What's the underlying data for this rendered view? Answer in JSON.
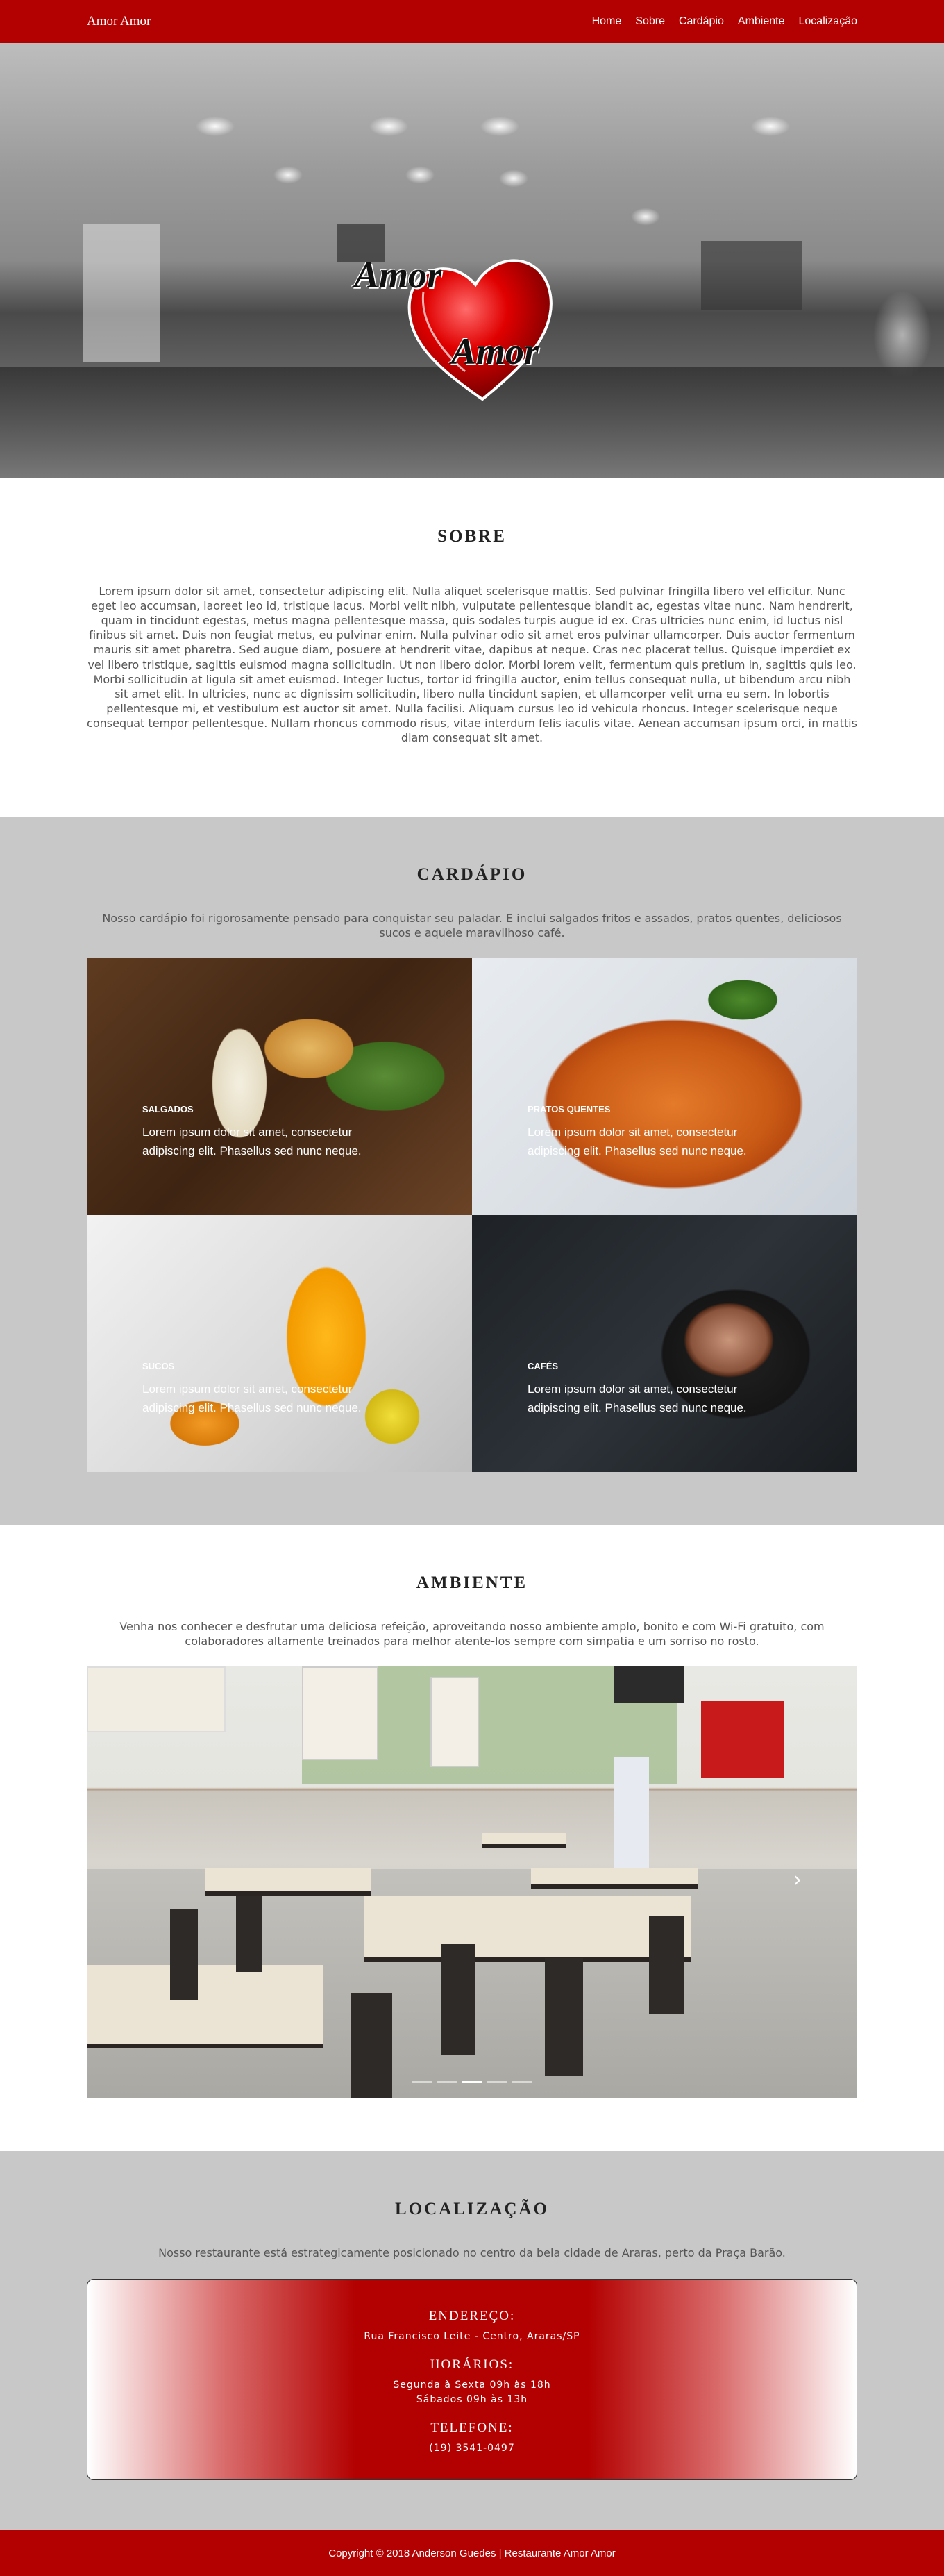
{
  "nav": {
    "brand": "Amor Amor",
    "links": [
      "Home",
      "Sobre",
      "Cardápio",
      "Ambiente",
      "Localização"
    ]
  },
  "hero": {
    "logo_line1": "Amor",
    "logo_line2": "Amor"
  },
  "sobre": {
    "title": "SOBRE",
    "text": "Lorem ipsum dolor sit amet, consectetur adipiscing elit. Nulla aliquet scelerisque mattis. Sed pulvinar fringilla libero vel efficitur. Nunc eget leo accumsan, laoreet leo id, tristique lacus. Morbi velit nibh, vulputate pellentesque blandit ac, egestas vitae nunc. Nam hendrerit, quam in tincidunt egestas, metus magna pellentesque massa, quis sodales turpis augue id ex. Cras ultricies nunc enim, id luctus nisl finibus sit amet. Duis non feugiat metus, eu pulvinar enim. Nulla pulvinar odio sit amet eros pulvinar ullamcorper. Duis auctor fermentum mauris sit amet pharetra. Sed augue diam, posuere at hendrerit vitae, dapibus at neque. Cras nec placerat tellus. Quisque imperdiet ex vel libero tristique, sagittis euismod magna sollicitudin. Ut non libero dolor. Morbi lorem velit, fermentum quis pretium in, sagittis quis leo. Morbi sollicitudin at ligula sit amet euismod. Integer luctus, tortor id fringilla auctor, enim tellus consequat nulla, ut bibendum arcu nibh sit amet elit. In ultricies, nunc ac dignissim sollicitudin, libero nulla tincidunt sapien, et ullamcorper velit urna eu sem. In lobortis pellentesque mi, et vestibulum est auctor sit amet. Nulla facilisi. Aliquam cursus leo id vehicula rhoncus. Integer scelerisque neque consequat tempor pellentesque. Nullam rhoncus commodo risus, vitae interdum felis iaculis vitae. Aenean accumsan ipsum orci, in mattis diam consequat sit amet."
  },
  "cardapio": {
    "title": "CARDÁPIO",
    "text": "Nosso cardápio foi rigorosamente pensado para conquistar seu paladar. E inclui salgados fritos e assados, pratos quentes, deliciosos sucos e aquele maravilhoso café.",
    "items": [
      {
        "label": "SALGADOS",
        "desc": "Lorem ipsum dolor sit amet, consectetur adipiscing elit. Phasellus sed nunc neque."
      },
      {
        "label": "PRATOS QUENTES",
        "desc": "Lorem ipsum dolor sit amet, consectetur adipiscing elit. Phasellus sed nunc neque."
      },
      {
        "label": "SUCOS",
        "desc": "Lorem ipsum dolor sit amet, consectetur adipiscing elit. Phasellus sed nunc neque."
      },
      {
        "label": "CAFÉS",
        "desc": "Lorem ipsum dolor sit amet, consectetur adipiscing elit. Phasellus sed nunc neque."
      }
    ]
  },
  "ambiente": {
    "title": "AMBIENTE",
    "text": "Venha nos conhecer e desfrutar uma deliciosa refeição, aproveitando nosso ambiente amplo, bonito e com Wi-Fi gratuito, com colaboradores altamente treinados para melhor atente-los sempre com simpatia e um sorriso no rosto.",
    "carousel": {
      "slide_count": 5,
      "active_index": 2,
      "next_icon": "chevron-right-icon"
    }
  },
  "localizacao": {
    "title": "LOCALIZAÇÃO",
    "text": "Nosso restaurante está estrategicamente posicionado no centro da bela cidade de Araras, perto da Praça Barão.",
    "endereco_label": "ENDEREÇO:",
    "endereco": "Rua Francisco Leite - Centro, Araras/SP",
    "horarios_label": "HORÁRIOS:",
    "horarios_1": "Segunda à Sexta 09h às 18h",
    "horarios_2": "Sábados 09h às 13h",
    "telefone_label": "TELEFONE:",
    "telefone": "(19) 3541-0497"
  },
  "footer": {
    "text": "Copyright © 2018 Anderson Guedes | Restaurante Amor Amor"
  },
  "colors": {
    "brand_red": "#b30000",
    "section_gray": "#c8c8c8"
  }
}
